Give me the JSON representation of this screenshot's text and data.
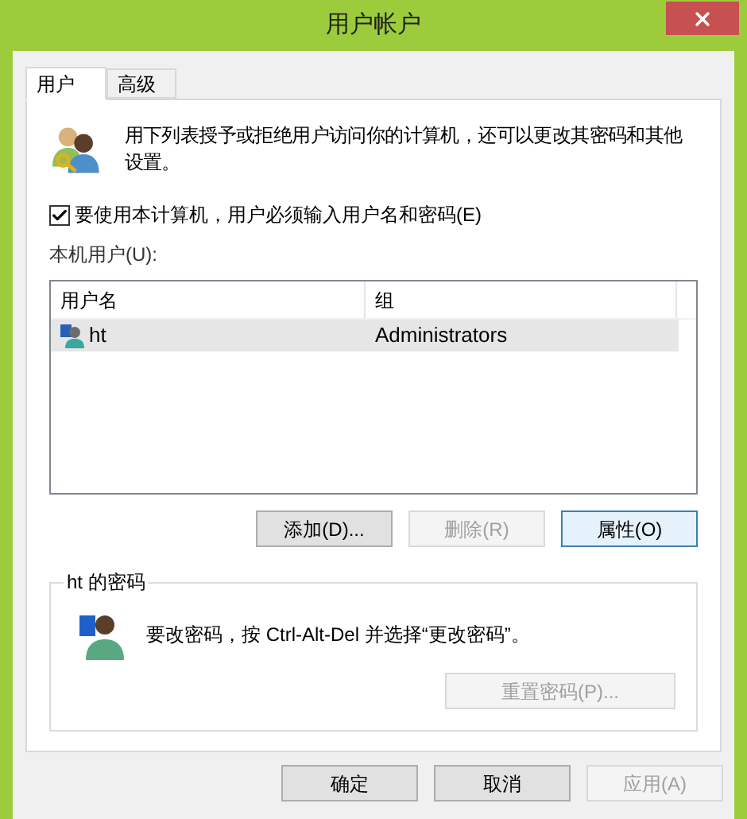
{
  "window": {
    "title": "用户帐户"
  },
  "tabs": [
    {
      "label": "用户",
      "selected": true
    },
    {
      "label": "高级",
      "selected": false
    }
  ],
  "description": "用下列表授予或拒绝用户访问你的计算机，还可以更改其密码和其他设置。",
  "require_login": {
    "label": "要使用本计算机，用户必须输入用户名和密码(E)",
    "checked": true
  },
  "users_label": "本机用户(U):",
  "table": {
    "columns": [
      "用户名",
      "组"
    ],
    "rows": [
      {
        "cells": [
          "ht",
          "Administrators"
        ],
        "selected": true
      }
    ]
  },
  "list_buttons": [
    {
      "label": "添加(D)...",
      "disabled": false,
      "focused": false
    },
    {
      "label": "删除(R)",
      "disabled": true,
      "focused": false
    },
    {
      "label": "属性(O)",
      "disabled": false,
      "focused": true
    }
  ],
  "password_group": {
    "title": "ht 的密码",
    "text": "要改密码，按 Ctrl-Alt-Del 并选择“更改密码”。",
    "button": {
      "label": "重置密码(P)...",
      "disabled": true
    }
  },
  "dialog_buttons": [
    {
      "label": "确定",
      "disabled": false
    },
    {
      "label": "取消",
      "disabled": false
    },
    {
      "label": "应用(A)",
      "disabled": true
    }
  ]
}
